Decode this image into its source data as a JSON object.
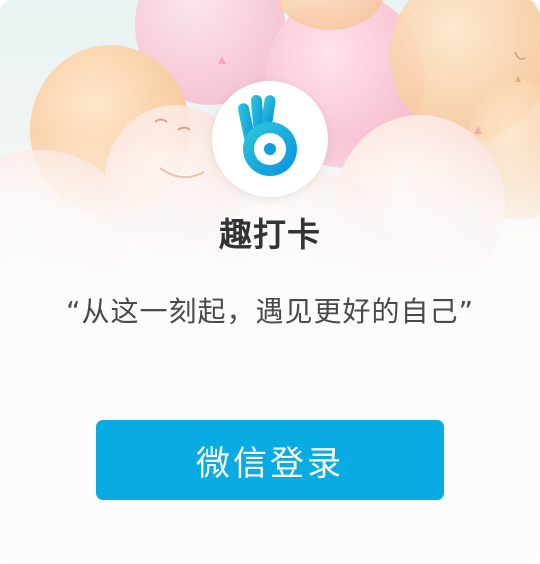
{
  "app": {
    "name": "趣打卡",
    "slogan": "“从这一刻起，遇见更好的自己”",
    "logo_icon": "ok-hand-eye-icon"
  },
  "actions": {
    "login_label": "微信登录"
  },
  "colors": {
    "accent": "#09ace2",
    "logo_gradient_start": "#2ecbd9",
    "logo_gradient_end": "#0a8fe0",
    "balloon_peach": "#f7c99a",
    "balloon_pink": "#f8c2d0"
  }
}
